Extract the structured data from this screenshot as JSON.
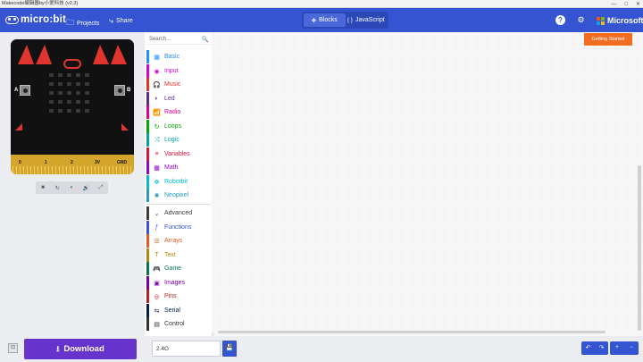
{
  "window": {
    "title": "Makecode编辑器by小爱科技 (v2.3)",
    "controls": [
      "—",
      "□",
      "✕"
    ]
  },
  "header": {
    "logo_text": "micro:bit",
    "projects_label": "Projects",
    "share_label": "Share",
    "tabs": [
      {
        "label": "Blocks",
        "icon": "puzzle-icon"
      },
      {
        "label": "JavaScript",
        "icon": "braces-icon"
      }
    ],
    "help_icon": "?",
    "settings_icon": "⚙",
    "microsoft_label": "Microsoft",
    "microsoft_colors": [
      "#f25022",
      "#7fba00",
      "#00a4ef",
      "#ffb900"
    ],
    "bar_color": "#3454d1"
  },
  "simulator": {
    "button_a": "A",
    "button_b": "B",
    "pins": [
      "0",
      "1",
      "2",
      "3V",
      "GND"
    ],
    "controls": [
      "■",
      "↻",
      "◐",
      "🔊",
      "⤢"
    ]
  },
  "toolbox": {
    "search_placeholder": "Search...",
    "search_icon": "🔍",
    "categories": [
      {
        "label": "Basic",
        "icon": "▦",
        "color": "#1e90ff"
      },
      {
        "label": "Input",
        "icon": "◉",
        "color": "#d400d4"
      },
      {
        "label": "Music",
        "icon": "🎧",
        "color": "#e63022"
      },
      {
        "label": "Led",
        "icon": "◐",
        "color": "#5c2d91"
      },
      {
        "label": "Radio",
        "icon": "📶",
        "color": "#e3008c"
      },
      {
        "label": "Loops",
        "icon": "↻",
        "color": "#00aa00"
      },
      {
        "label": "Logic",
        "icon": "⤨",
        "color": "#00a4a6"
      },
      {
        "label": "Variables",
        "icon": "≡",
        "color": "#dc143c"
      },
      {
        "label": "Math",
        "icon": "▦",
        "color": "#9400d3"
      },
      {
        "label": "Robotbit",
        "icon": "☸",
        "color": "#00bcd4"
      },
      {
        "label": "Neopixel",
        "icon": "✺",
        "color": "#2699bf"
      },
      {
        "label": "Advanced",
        "icon": "⌄",
        "color": "#3c3c3c"
      },
      {
        "label": "Functions",
        "icon": "ƒ",
        "color": "#3455db"
      },
      {
        "label": "Arrays",
        "icon": "☰",
        "color": "#e65722"
      },
      {
        "label": "Text",
        "icon": "T",
        "color": "#b8860b"
      },
      {
        "label": "Game",
        "icon": "🎮",
        "color": "#007a4b"
      },
      {
        "label": "Images",
        "icon": "▣",
        "color": "#7600a8"
      },
      {
        "label": "Pins",
        "icon": "◎",
        "color": "#b22222"
      },
      {
        "label": "Serial",
        "icon": "⇆",
        "color": "#002050"
      },
      {
        "label": "Control",
        "icon": "▤",
        "color": "#333333"
      }
    ]
  },
  "workspace": {
    "getting_started_label": "Getting Started"
  },
  "bottom": {
    "collapse_icon": "⊡",
    "download_label": "Download",
    "download_icon": "⭳",
    "project_name": "2.4G",
    "save_icon": "💾",
    "undo_icon": "↶",
    "redo_icon": "↷",
    "zoom_in_icon": "+",
    "zoom_out_icon": "−"
  }
}
